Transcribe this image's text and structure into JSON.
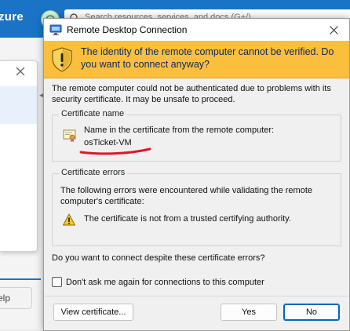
{
  "background": {
    "brand": "zure",
    "search_placeholder": "Search resources, services, and docs (G+/)",
    "blade_pill": "elp"
  },
  "dialog": {
    "title": "Remote Desktop Connection",
    "warning_heading": "The identity of the remote computer cannot be verified. Do you want to connect anyway?",
    "intro": "The remote computer could not be authenticated due to problems with its security certificate. It may be unsafe to proceed.",
    "cert_group": {
      "legend": "Certificate name",
      "label": "Name in the certificate from the remote computer:",
      "value": "osTicket-VM"
    },
    "errors_group": {
      "legend": "Certificate errors",
      "description": "The following errors were encountered while validating the remote computer's certificate:",
      "items": [
        "The certificate is not from a trusted certifying authority."
      ]
    },
    "question": "Do you want to connect despite these certificate errors?",
    "checkbox": {
      "label": "Don't ask me again for connections to this computer",
      "checked": false
    },
    "buttons": {
      "view": "View certificate...",
      "yes": "Yes",
      "no": "No"
    }
  },
  "colors": {
    "banner": "#fbbf3e",
    "banner_text": "#0b2a63",
    "annotation": "#e0162b",
    "azure_blue": "#1b73c6"
  }
}
